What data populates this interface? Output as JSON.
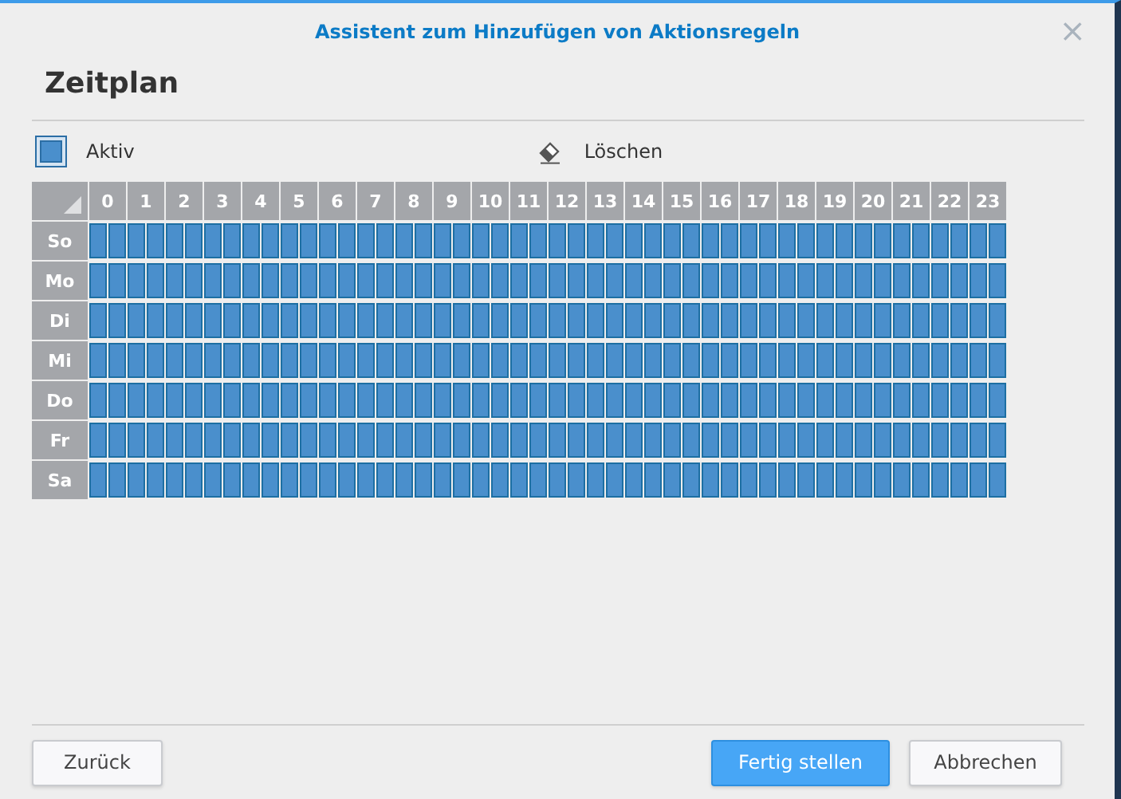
{
  "window": {
    "title": "Assistent zum Hinzufügen von Aktionsregeln",
    "close": "×"
  },
  "heading": "Zeitplan",
  "tools": [
    {
      "kind": "active",
      "label": "Aktiv",
      "selected": true
    },
    {
      "kind": "erase",
      "label": "Löschen",
      "selected": false
    }
  ],
  "hours": [
    "0",
    "1",
    "2",
    "3",
    "4",
    "5",
    "6",
    "7",
    "8",
    "9",
    "10",
    "11",
    "12",
    "13",
    "14",
    "15",
    "16",
    "17",
    "18",
    "19",
    "20",
    "21",
    "22",
    "23"
  ],
  "days": [
    {
      "label": "So",
      "slots": [
        true,
        true,
        true,
        true,
        true,
        true,
        true,
        true,
        true,
        true,
        true,
        true,
        true,
        true,
        true,
        true,
        true,
        true,
        true,
        true,
        true,
        true,
        true,
        true,
        true,
        true,
        true,
        true,
        true,
        true,
        true,
        true,
        true,
        true,
        true,
        true,
        true,
        true,
        true,
        true,
        true,
        true,
        true,
        true,
        true,
        true,
        true,
        true
      ]
    },
    {
      "label": "Mo",
      "slots": [
        true,
        true,
        true,
        true,
        true,
        true,
        true,
        true,
        true,
        true,
        true,
        true,
        true,
        true,
        true,
        true,
        true,
        true,
        true,
        true,
        true,
        true,
        true,
        true,
        true,
        true,
        true,
        true,
        true,
        true,
        true,
        true,
        true,
        true,
        true,
        true,
        true,
        true,
        true,
        true,
        true,
        true,
        true,
        true,
        true,
        true,
        true,
        true
      ]
    },
    {
      "label": "Di",
      "slots": [
        true,
        true,
        true,
        true,
        true,
        true,
        true,
        true,
        true,
        true,
        true,
        true,
        true,
        true,
        true,
        true,
        true,
        true,
        true,
        true,
        true,
        true,
        true,
        true,
        true,
        true,
        true,
        true,
        true,
        true,
        true,
        true,
        true,
        true,
        true,
        true,
        true,
        true,
        true,
        true,
        true,
        true,
        true,
        true,
        true,
        true,
        true,
        true
      ]
    },
    {
      "label": "Mi",
      "slots": [
        true,
        true,
        true,
        true,
        true,
        true,
        true,
        true,
        true,
        true,
        true,
        true,
        true,
        true,
        true,
        true,
        true,
        true,
        true,
        true,
        true,
        true,
        true,
        true,
        true,
        true,
        true,
        true,
        true,
        true,
        true,
        true,
        true,
        true,
        true,
        true,
        true,
        true,
        true,
        true,
        true,
        true,
        true,
        true,
        true,
        true,
        true,
        true
      ]
    },
    {
      "label": "Do",
      "slots": [
        true,
        true,
        true,
        true,
        true,
        true,
        true,
        true,
        true,
        true,
        true,
        true,
        true,
        true,
        true,
        true,
        true,
        true,
        true,
        true,
        true,
        true,
        true,
        true,
        true,
        true,
        true,
        true,
        true,
        true,
        true,
        true,
        true,
        true,
        true,
        true,
        true,
        true,
        true,
        true,
        true,
        true,
        true,
        true,
        true,
        true,
        true,
        true
      ]
    },
    {
      "label": "Fr",
      "slots": [
        true,
        true,
        true,
        true,
        true,
        true,
        true,
        true,
        true,
        true,
        true,
        true,
        true,
        true,
        true,
        true,
        true,
        true,
        true,
        true,
        true,
        true,
        true,
        true,
        true,
        true,
        true,
        true,
        true,
        true,
        true,
        true,
        true,
        true,
        true,
        true,
        true,
        true,
        true,
        true,
        true,
        true,
        true,
        true,
        true,
        true,
        true,
        true
      ]
    },
    {
      "label": "Sa",
      "slots": [
        true,
        true,
        true,
        true,
        true,
        true,
        true,
        true,
        true,
        true,
        true,
        true,
        true,
        true,
        true,
        true,
        true,
        true,
        true,
        true,
        true,
        true,
        true,
        true,
        true,
        true,
        true,
        true,
        true,
        true,
        true,
        true,
        true,
        true,
        true,
        true,
        true,
        true,
        true,
        true,
        true,
        true,
        true,
        true,
        true,
        true,
        true,
        true
      ]
    }
  ],
  "buttons": [
    {
      "kind": "back",
      "label": "Zurück"
    },
    {
      "kind": "primary",
      "label": "Fertig stellen"
    },
    {
      "kind": "cancel",
      "label": "Abbrechen"
    }
  ]
}
